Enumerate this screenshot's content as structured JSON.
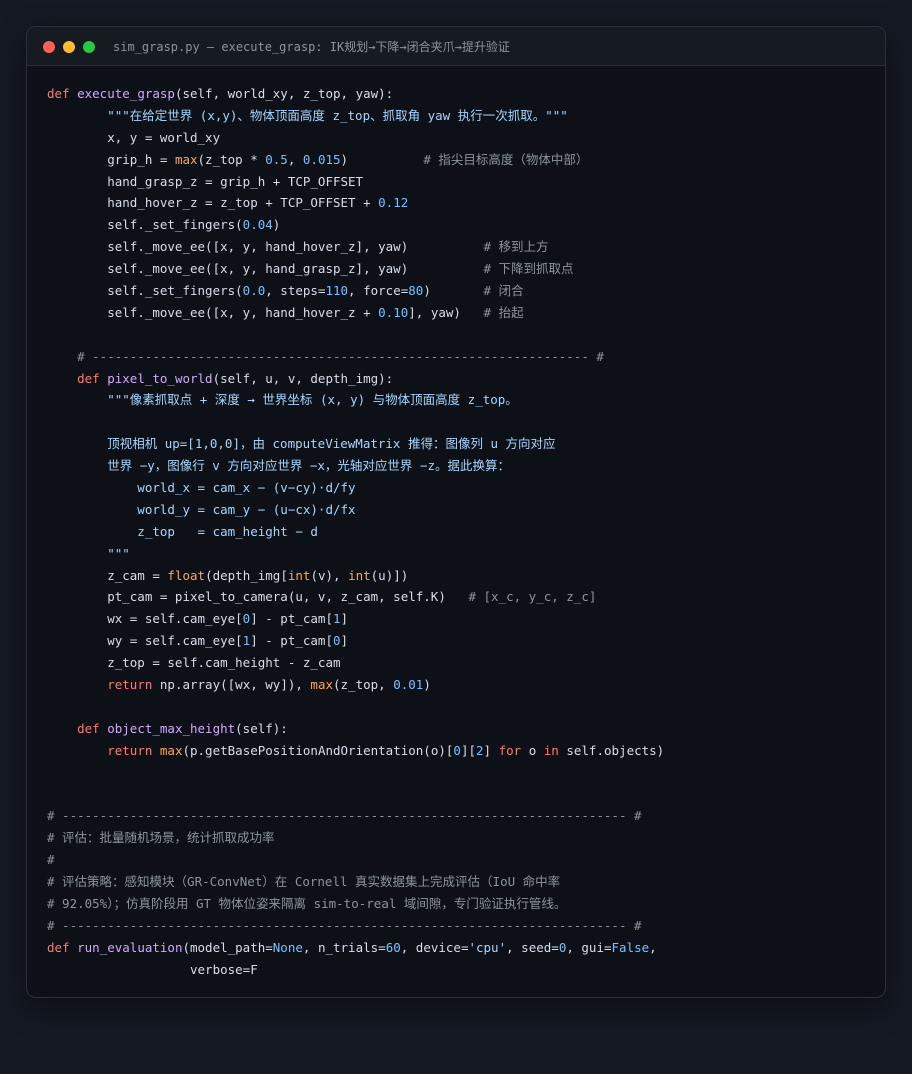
{
  "window": {
    "title": "sim_grasp.py — execute_grasp: IK规划→下降→闭合夹爪→提升验证"
  },
  "code": {
    "lines": [
      [
        [
          "def ",
          "kw"
        ],
        [
          "execute_grasp",
          "fn"
        ],
        [
          "(self, world_xy, z_top, yaw):",
          "txt"
        ]
      ],
      [
        [
          "        \"\"\"在给定世界 (x,y)、物体顶面高度 z_top、抓取角 yaw 执行一次抓取。\"\"\"",
          "str"
        ]
      ],
      [
        [
          "        x, y = world_xy",
          "txt"
        ]
      ],
      [
        [
          "        grip_h = ",
          "txt"
        ],
        [
          "max",
          "bi"
        ],
        [
          "(z_top * ",
          "txt"
        ],
        [
          "0.5",
          "num"
        ],
        [
          ", ",
          "txt"
        ],
        [
          "0.015",
          "num"
        ],
        [
          ")          ",
          "txt"
        ],
        [
          "# 指尖目标高度（物体中部）",
          "cm"
        ]
      ],
      [
        [
          "        hand_grasp_z = grip_h + TCP_OFFSET",
          "txt"
        ]
      ],
      [
        [
          "        hand_hover_z = z_top + TCP_OFFSET + ",
          "txt"
        ],
        [
          "0.12",
          "num"
        ]
      ],
      [
        [
          "        self._set_fingers(",
          "txt"
        ],
        [
          "0.04",
          "num"
        ],
        [
          ")",
          "txt"
        ]
      ],
      [
        [
          "        self._move_ee([x, y, hand_hover_z], yaw)          ",
          "txt"
        ],
        [
          "# 移到上方",
          "cm"
        ]
      ],
      [
        [
          "        self._move_ee([x, y, hand_grasp_z], yaw)          ",
          "txt"
        ],
        [
          "# 下降到抓取点",
          "cm"
        ]
      ],
      [
        [
          "        self._set_fingers(",
          "txt"
        ],
        [
          "0.0",
          "num"
        ],
        [
          ", steps=",
          "txt"
        ],
        [
          "110",
          "num"
        ],
        [
          ", force=",
          "txt"
        ],
        [
          "80",
          "num"
        ],
        [
          ")       ",
          "txt"
        ],
        [
          "# 闭合",
          "cm"
        ]
      ],
      [
        [
          "        self._move_ee([x, y, hand_hover_z + ",
          "txt"
        ],
        [
          "0.10",
          "num"
        ],
        [
          "], yaw)   ",
          "txt"
        ],
        [
          "# 抬起",
          "cm"
        ]
      ],
      [
        [
          "",
          "txt"
        ]
      ],
      [
        [
          "    # ------------------------------------------------------------------ #",
          "cm"
        ]
      ],
      [
        [
          "    ",
          "txt"
        ],
        [
          "def ",
          "kw"
        ],
        [
          "pixel_to_world",
          "fn"
        ],
        [
          "(self, u, v, depth_img):",
          "txt"
        ]
      ],
      [
        [
          "        \"\"\"像素抓取点 + 深度 → 世界坐标 (x, y) 与物体顶面高度 z_top。",
          "str"
        ]
      ],
      [
        [
          "",
          "txt"
        ]
      ],
      [
        [
          "        顶视相机 up=[1,0,0]，由 computeViewMatrix 推得：图像列 u 方向对应",
          "str"
        ]
      ],
      [
        [
          "        世界 −y，图像行 v 方向对应世界 −x，光轴对应世界 −z。据此换算：",
          "str"
        ]
      ],
      [
        [
          "            world_x = cam_x − (v−cy)·d/fy",
          "str"
        ]
      ],
      [
        [
          "            world_y = cam_y − (u−cx)·d/fx",
          "str"
        ]
      ],
      [
        [
          "            z_top   = cam_height − d",
          "str"
        ]
      ],
      [
        [
          "        \"\"\"",
          "str"
        ]
      ],
      [
        [
          "        z_cam = ",
          "txt"
        ],
        [
          "float",
          "bi"
        ],
        [
          "(depth_img[",
          "txt"
        ],
        [
          "int",
          "bi"
        ],
        [
          "(v), ",
          "txt"
        ],
        [
          "int",
          "bi"
        ],
        [
          "(u)])",
          "txt"
        ]
      ],
      [
        [
          "        pt_cam = pixel_to_camera(u, v, z_cam, self.K)   ",
          "txt"
        ],
        [
          "# [x_c, y_c, z_c]",
          "cm"
        ]
      ],
      [
        [
          "        wx = self.cam_eye[",
          "txt"
        ],
        [
          "0",
          "num"
        ],
        [
          "] - pt_cam[",
          "txt"
        ],
        [
          "1",
          "num"
        ],
        [
          "]",
          "txt"
        ]
      ],
      [
        [
          "        wy = self.cam_eye[",
          "txt"
        ],
        [
          "1",
          "num"
        ],
        [
          "] - pt_cam[",
          "txt"
        ],
        [
          "0",
          "num"
        ],
        [
          "]",
          "txt"
        ]
      ],
      [
        [
          "        z_top = self.cam_height - z_cam",
          "txt"
        ]
      ],
      [
        [
          "        ",
          "txt"
        ],
        [
          "return ",
          "kw"
        ],
        [
          "np.array([wx, wy]), ",
          "txt"
        ],
        [
          "max",
          "bi"
        ],
        [
          "(z_top, ",
          "txt"
        ],
        [
          "0.01",
          "num"
        ],
        [
          ")",
          "txt"
        ]
      ],
      [
        [
          "",
          "txt"
        ]
      ],
      [
        [
          "    ",
          "txt"
        ],
        [
          "def ",
          "kw"
        ],
        [
          "object_max_height",
          "fn"
        ],
        [
          "(self):",
          "txt"
        ]
      ],
      [
        [
          "        ",
          "txt"
        ],
        [
          "return ",
          "kw"
        ],
        [
          "max",
          "bi"
        ],
        [
          "(p.getBasePositionAndOrientation(o)[",
          "txt"
        ],
        [
          "0",
          "num"
        ],
        [
          "][",
          "txt"
        ],
        [
          "2",
          "num"
        ],
        [
          "] ",
          "txt"
        ],
        [
          "for ",
          "kw"
        ],
        [
          "o ",
          "txt"
        ],
        [
          "in ",
          "kw"
        ],
        [
          "self.objects)",
          "txt"
        ]
      ],
      [
        [
          "",
          "txt"
        ]
      ],
      [
        [
          "",
          "txt"
        ]
      ],
      [
        [
          "# --------------------------------------------------------------------------- #",
          "cm"
        ]
      ],
      [
        [
          "# 评估：批量随机场景，统计抓取成功率",
          "cm"
        ]
      ],
      [
        [
          "#",
          "cm"
        ]
      ],
      [
        [
          "# 评估策略：感知模块（GR-ConvNet）在 Cornell 真实数据集上完成评估（IoU 命中率",
          "cm"
        ]
      ],
      [
        [
          "# 92.05%）；仿真阶段用 GT 物体位姿来隔离 sim-to-real 域间隙，专门验证执行管线。",
          "cm"
        ]
      ],
      [
        [
          "# --------------------------------------------------------------------------- #",
          "cm"
        ]
      ],
      [
        [
          "def ",
          "kw"
        ],
        [
          "run_evaluation",
          "fn"
        ],
        [
          "(model_path=",
          "txt"
        ],
        [
          "None",
          "num"
        ],
        [
          ", n_trials=",
          "txt"
        ],
        [
          "60",
          "num"
        ],
        [
          ", device=",
          "txt"
        ],
        [
          "'cpu'",
          "str"
        ],
        [
          ", seed=",
          "txt"
        ],
        [
          "0",
          "num"
        ],
        [
          ", gui=",
          "txt"
        ],
        [
          "False",
          "num"
        ],
        [
          ",",
          "txt"
        ]
      ],
      [
        [
          "                   verbose=F",
          "txt"
        ]
      ]
    ]
  },
  "colors": {
    "background": "#141923",
    "editor": "#0d1117",
    "keyword": "#ff7b72",
    "function": "#d2a8ff",
    "number": "#79c0ff",
    "comment": "#8b949e",
    "string": "#a5d6ff",
    "builtin": "#ffa657"
  }
}
